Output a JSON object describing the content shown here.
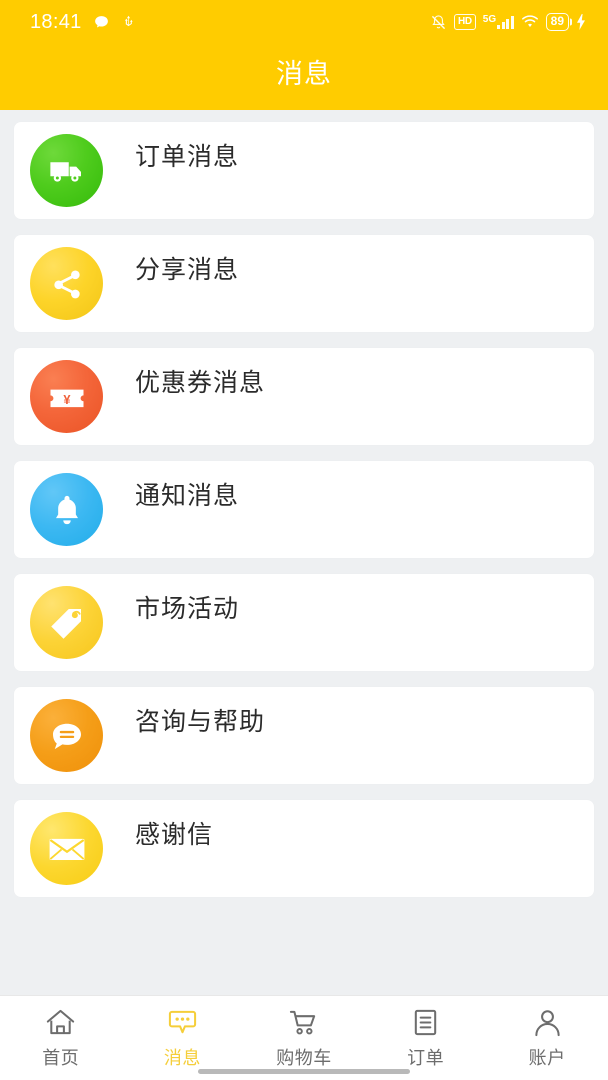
{
  "status_bar": {
    "time": "18:41",
    "left_icons": [
      "chat-bubble-icon",
      "usb-icon"
    ],
    "mute_icon": "bell-muted-icon",
    "hd_label": "HD",
    "network_label": "5G",
    "wifi_icon": "wifi-icon",
    "battery_level": "89",
    "charging_icon": "lightning-bolt-icon"
  },
  "header": {
    "title": "消息",
    "background_color": "#FFCC00",
    "title_color": "#FFFFFF"
  },
  "page": {
    "background_color": "#EEF0F2"
  },
  "list": {
    "items": [
      {
        "label": "订单消息",
        "icon": "truck-icon",
        "color": "#4FCC1D",
        "style": "ib-green"
      },
      {
        "label": "分享消息",
        "icon": "share-nodes-icon",
        "color": "#FDD429",
        "style": "ib-yellow"
      },
      {
        "label": "优惠券消息",
        "icon": "coupon-ticket-icon",
        "color": "#F4663A",
        "style": "ib-orange"
      },
      {
        "label": "通知消息",
        "icon": "bell-icon",
        "color": "#3CB8F2",
        "style": "ib-blue"
      },
      {
        "label": "市场活动",
        "icon": "price-tag-icon",
        "color": "#FCD336",
        "style": "ib-gold"
      },
      {
        "label": "咨询与帮助",
        "icon": "chat-bubble-icon",
        "color": "#F59E18",
        "style": "ib-amber"
      },
      {
        "label": "感谢信",
        "icon": "envelope-icon",
        "color": "#FCD72F",
        "style": "ib-lemon"
      }
    ]
  },
  "tabbar": {
    "active_color": "#F5CE3A",
    "inactive_color": "#6D6D6D",
    "tabs": [
      {
        "label": "首页",
        "icon": "home-icon",
        "active": false
      },
      {
        "label": "消息",
        "icon": "message-bubble-icon",
        "active": true
      },
      {
        "label": "购物车",
        "icon": "shopping-cart-icon",
        "active": false
      },
      {
        "label": "订单",
        "icon": "order-list-icon",
        "active": false
      },
      {
        "label": "账户",
        "icon": "user-account-icon",
        "active": false
      }
    ]
  }
}
